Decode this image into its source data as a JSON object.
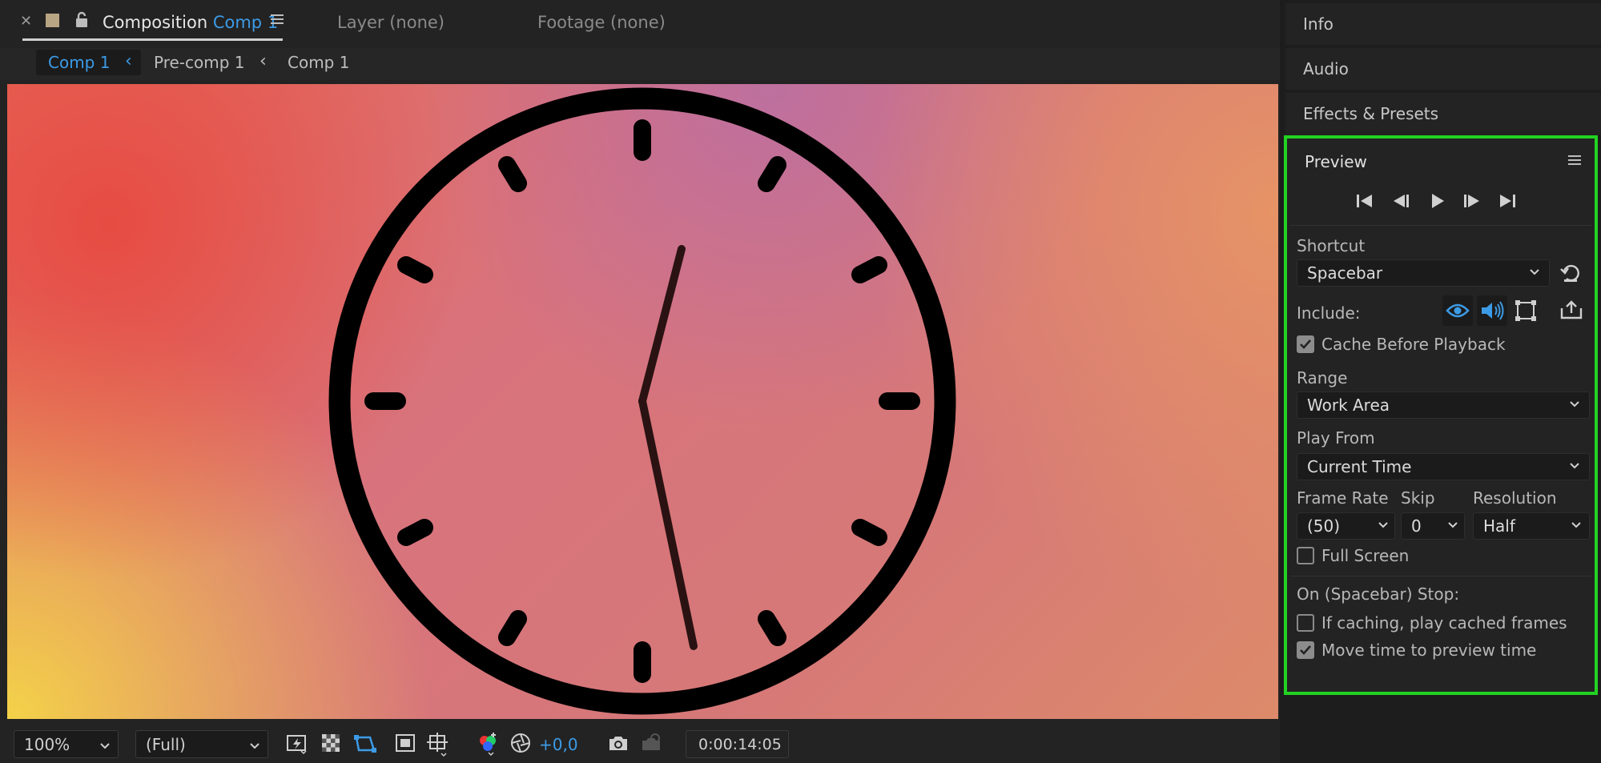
{
  "tabs": {
    "composition_label": "Composition",
    "composition_name": "Comp 1",
    "layer": "Layer (none)",
    "footage": "Footage (none)"
  },
  "breadcrumbs": [
    "Comp 1",
    "Pre-comp 1",
    "Comp 1"
  ],
  "viewer_toolbar": {
    "zoom": "100%",
    "resolution": "(Full)",
    "exposure": "+0,0",
    "timecode": "0:00:14:05"
  },
  "right_panels": {
    "info": "Info",
    "audio": "Audio",
    "effects": "Effects & Presets"
  },
  "preview": {
    "title": "Preview",
    "shortcut_label": "Shortcut",
    "shortcut_value": "Spacebar",
    "include_label": "Include:",
    "cache_label": "Cache Before Playback",
    "cache_checked": true,
    "range_label": "Range",
    "range_value": "Work Area",
    "play_from_label": "Play From",
    "play_from_value": "Current Time",
    "frame_rate_label": "Frame Rate",
    "frame_rate_value": "(50)",
    "skip_label": "Skip",
    "skip_value": "0",
    "resolution_label": "Resolution",
    "resolution_value": "Half",
    "full_screen_label": "Full Screen",
    "full_screen_checked": false,
    "stop_label": "On (Spacebar) Stop:",
    "if_caching_label": "If caching, play cached frames",
    "if_caching_checked": false,
    "move_time_label": "Move time to preview time",
    "move_time_checked": true
  },
  "colors": {
    "accent_blue": "#3c9be6",
    "highlight_green": "#22d322",
    "panel_bg": "#232323"
  }
}
